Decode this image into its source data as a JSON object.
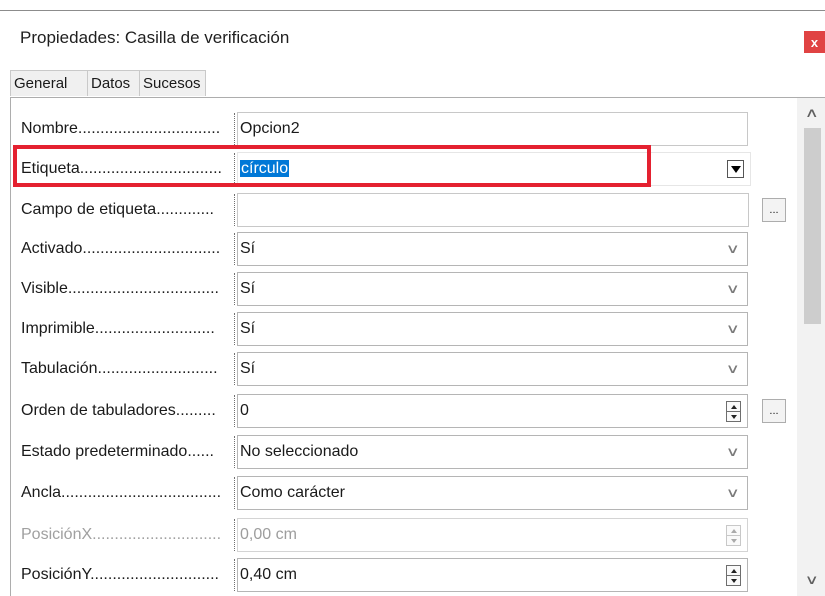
{
  "window": {
    "title": "Propiedades: Casilla de verificación",
    "close_label": "x"
  },
  "tabs": [
    {
      "label": "General",
      "active": true
    },
    {
      "label": "Datos",
      "active": false
    },
    {
      "label": "Sucesos",
      "active": false
    }
  ],
  "properties": {
    "nombre": {
      "label": "Nombre................................",
      "value": "Opcion2"
    },
    "etiqueta": {
      "label": "Etiqueta................................",
      "value": "círculo"
    },
    "campo_etiqueta": {
      "label": "Campo de etiqueta.............",
      "value": "",
      "button": "..."
    },
    "activado": {
      "label": "Activado...............................",
      "value": "Sí"
    },
    "visible": {
      "label": "Visible..................................",
      "value": "Sí"
    },
    "imprimible": {
      "label": "Imprimible...........................",
      "value": "Sí"
    },
    "tabulacion": {
      "label": "Tabulación...........................",
      "value": "Sí"
    },
    "orden_tabuladores": {
      "label": "Orden de tabuladores.........",
      "value": "0",
      "button": "..."
    },
    "estado_predeterminado": {
      "label": "Estado predeterminado......",
      "value": "No seleccionado"
    },
    "ancla": {
      "label": "Ancla....................................",
      "value": "Como carácter"
    },
    "posicion_x": {
      "label": "PosiciónX.............................",
      "value": "0,00 cm",
      "disabled": true
    },
    "posicion_y": {
      "label": "PosiciónY.............................",
      "value": "0,40 cm"
    }
  },
  "icons": {
    "dropdown": "chevron-down-icon",
    "combo": "triangle-down-icon",
    "spin": "spin-up-down-icon",
    "scroll_up": "chevron-up-icon",
    "scroll_down": "chevron-down-icon"
  },
  "colors": {
    "close_button": "#e04343",
    "highlight_border": "#e42130",
    "selection": "#0078d7"
  }
}
